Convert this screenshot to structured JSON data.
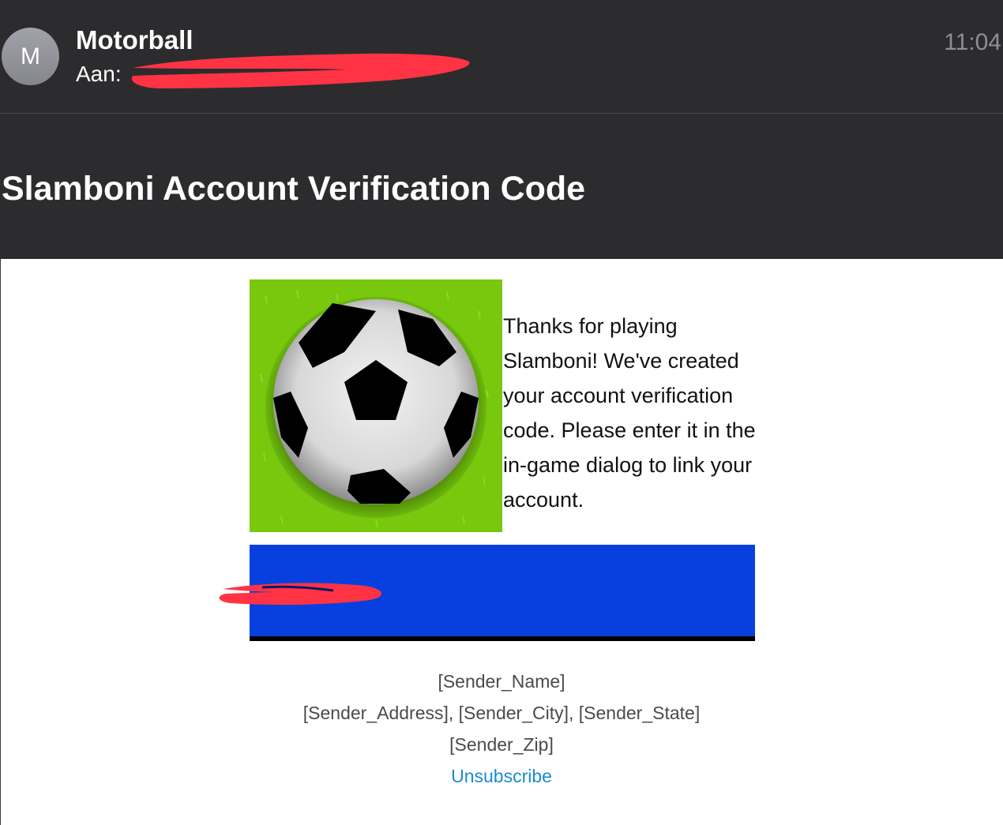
{
  "header": {
    "avatar_initial": "M",
    "sender_name": "Motorball",
    "to_label": "Aan:",
    "time": "11:04"
  },
  "subject": "Slamboni Account Verification Code",
  "body": {
    "intro_text": "Thanks for playing Slamboni!  We've created your account verification code.  Please enter it in the in-game dialog to link your account.",
    "code_box_color": "#0840e0"
  },
  "footer": {
    "sender_name": "[Sender_Name]",
    "address_line": "[Sender_Address], [Sender_City], [Sender_State]",
    "zip": "[Sender_Zip]",
    "unsubscribe_label": "Unsubscribe"
  },
  "colors": {
    "header_bg": "#2c2c2e",
    "link": "#1a8ad4",
    "redaction": "#ff3344"
  },
  "icons": {
    "game_logo": "soccer-ball-icon"
  }
}
